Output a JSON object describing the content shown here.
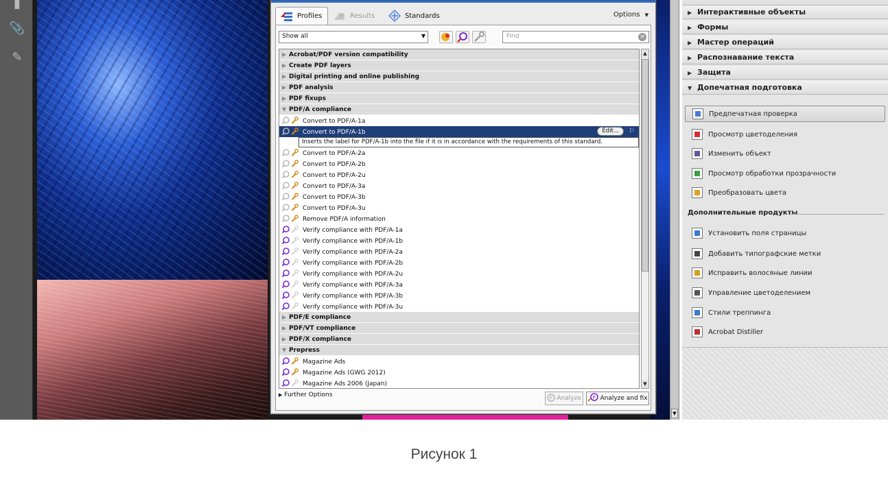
{
  "preflight": {
    "tabs": {
      "profiles": "Profiles",
      "results": "Results",
      "standards": "Standards",
      "options": "Options"
    },
    "show_filter": "Show all",
    "find_placeholder": "Find",
    "tree": [
      {
        "kind": "cat",
        "state": "closed",
        "label": "Acrobat/PDF version compatibility"
      },
      {
        "kind": "cat",
        "state": "closed",
        "label": "Create PDF layers"
      },
      {
        "kind": "cat",
        "state": "closed",
        "label": "Digital printing and online publishing"
      },
      {
        "kind": "cat",
        "state": "closed",
        "label": "PDF analysis"
      },
      {
        "kind": "cat",
        "state": "closed",
        "label": "PDF fixups"
      },
      {
        "kind": "cat",
        "state": "open",
        "label": "PDF/A compliance"
      },
      {
        "kind": "fix",
        "label": "Convert to PDF/A-1a"
      },
      {
        "kind": "fix",
        "label": "Convert to PDF/A-1b",
        "selected": true,
        "edit": "Edit..."
      },
      {
        "kind": "desc",
        "label": "Inserts the label for PDF/A-1b into the file if it is in accordance with the requirements of this standard."
      },
      {
        "kind": "fix",
        "label": "Convert to PDF/A-2a"
      },
      {
        "kind": "fix",
        "label": "Convert to PDF/A-2b"
      },
      {
        "kind": "fix",
        "label": "Convert to PDF/A-2u"
      },
      {
        "kind": "fix",
        "label": "Convert to PDF/A-3a"
      },
      {
        "kind": "fix",
        "label": "Convert to PDF/A-3b"
      },
      {
        "kind": "fix",
        "label": "Convert to PDF/A-3u"
      },
      {
        "kind": "fix",
        "label": "Remove PDF/A information"
      },
      {
        "kind": "check",
        "label": "Verify compliance with PDF/A-1a"
      },
      {
        "kind": "check",
        "label": "Verify compliance with PDF/A-1b"
      },
      {
        "kind": "check",
        "label": "Verify compliance with PDF/A-2a"
      },
      {
        "kind": "check",
        "label": "Verify compliance with PDF/A-2b"
      },
      {
        "kind": "check",
        "label": "Verify compliance with PDF/A-2u"
      },
      {
        "kind": "check",
        "label": "Verify compliance with PDF/A-3a"
      },
      {
        "kind": "check",
        "label": "Verify compliance with PDF/A-3b"
      },
      {
        "kind": "check",
        "label": "Verify compliance with PDF/A-3u"
      },
      {
        "kind": "cat",
        "state": "closed",
        "label": "PDF/E compliance"
      },
      {
        "kind": "cat",
        "state": "closed",
        "label": "PDF/VT compliance"
      },
      {
        "kind": "cat",
        "state": "closed",
        "label": "PDF/X compliance"
      },
      {
        "kind": "cat",
        "state": "open",
        "label": "Prepress"
      },
      {
        "kind": "both",
        "label": "Magazine Ads"
      },
      {
        "kind": "both",
        "label": "Magazine Ads (GWG 2012)"
      },
      {
        "kind": "check",
        "label": "Magazine Ads 2006 (Japan)"
      }
    ],
    "further_options": "Further Options",
    "analyze": "Analyze",
    "analyze_fix": "Analyze and fix"
  },
  "tools_pane": {
    "sections": [
      {
        "label": "Интерактивные объекты",
        "expanded": false
      },
      {
        "label": "Формы",
        "expanded": false
      },
      {
        "label": "Мастер операций",
        "expanded": false
      },
      {
        "label": "Распознавание текста",
        "expanded": false
      },
      {
        "label": "Защита",
        "expanded": false
      },
      {
        "label": "Допечатная подготовка",
        "expanded": true
      }
    ],
    "prepress_tools": [
      {
        "label": "Предпечатная проверка",
        "icon": "preflight-icon",
        "active": true
      },
      {
        "label": "Просмотр цветоделения",
        "icon": "separations-icon"
      },
      {
        "label": "Изменить объект",
        "icon": "edit-object-icon"
      },
      {
        "label": "Просмотр обработки прозрачности",
        "icon": "flattener-icon"
      },
      {
        "label": "Преобразовать цвета",
        "icon": "convert-colors-icon"
      }
    ],
    "addons_title": "Дополнительные продукты",
    "addon_tools": [
      {
        "label": "Установить поля страницы",
        "icon": "page-boxes-icon"
      },
      {
        "label": "Добавить типографские метки",
        "icon": "printer-marks-icon"
      },
      {
        "label": "Исправить волосяные линии",
        "icon": "hairlines-icon"
      },
      {
        "label": "Управление цветоделением",
        "icon": "ink-manager-icon"
      },
      {
        "label": "Стили треппинга",
        "icon": "trap-presets-icon"
      },
      {
        "label": "Acrobat Distiller",
        "icon": "distiller-icon"
      }
    ]
  },
  "caption": "Рисунок 1",
  "colors": {
    "selection": "#1f3f7a",
    "category_bg": "#dcdcdc",
    "check_icon": "#7a2bd1",
    "fix_icon": "#d08a1a"
  }
}
